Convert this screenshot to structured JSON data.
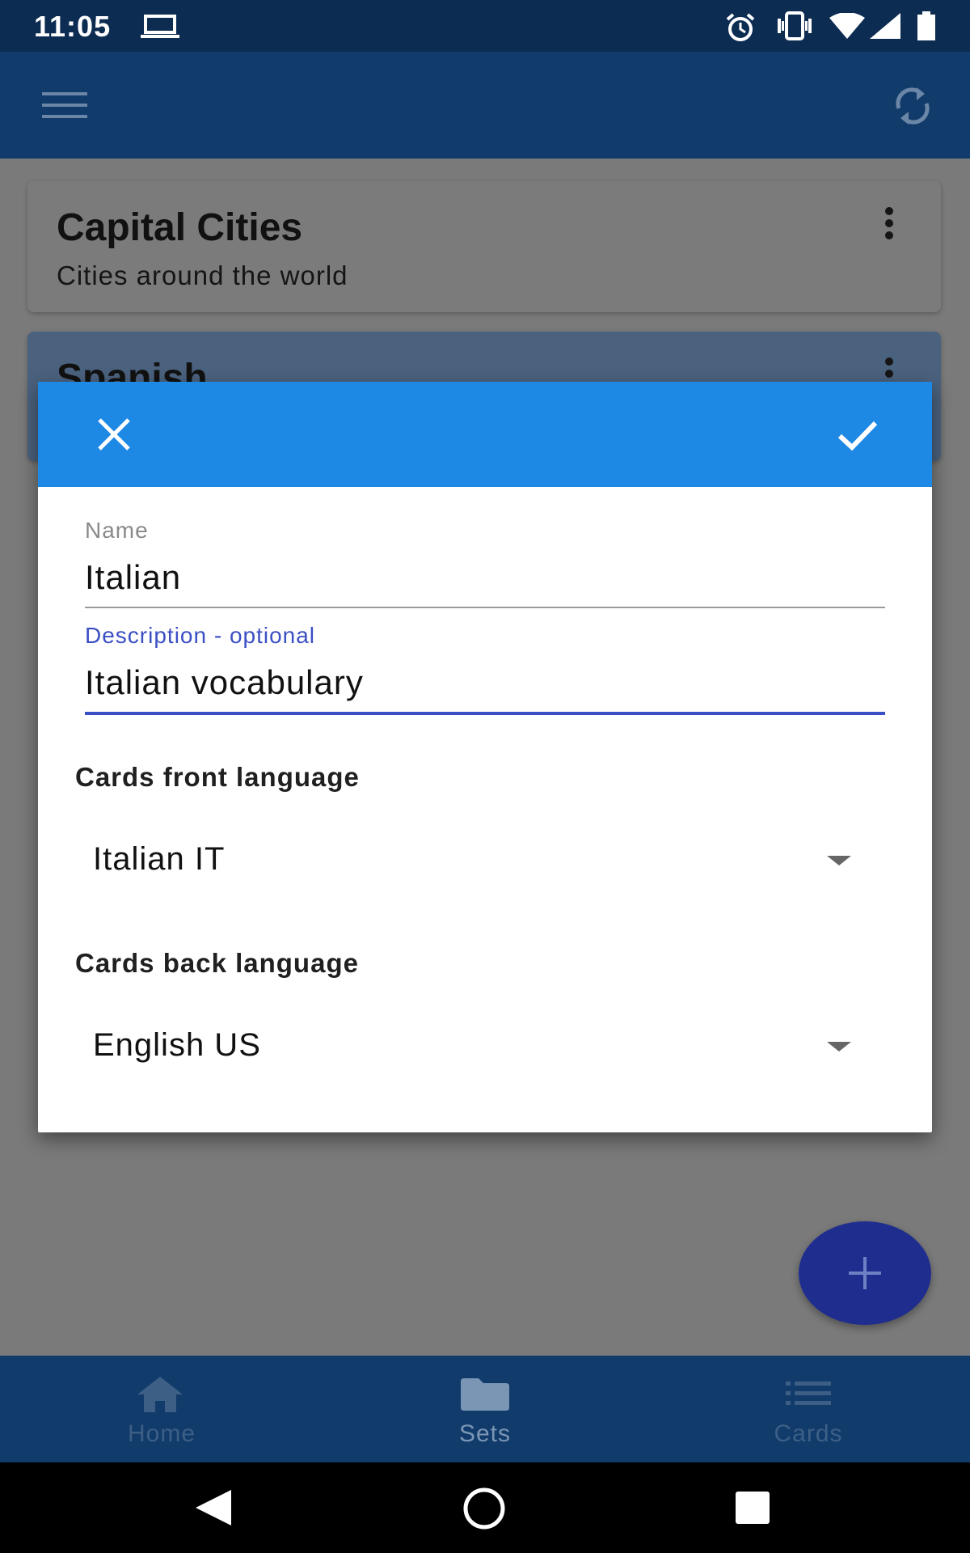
{
  "status_bar": {
    "time": "11:05",
    "icons": [
      "laptop-icon",
      "alarm-icon",
      "vibrate-icon",
      "wifi-icon",
      "signal-icon",
      "battery-icon"
    ]
  },
  "app_bar": {
    "menu_icon": "hamburger-menu-icon",
    "sync_icon": "sync-icon"
  },
  "sets": [
    {
      "title": "Capital Cities",
      "description": "Cities around the world"
    },
    {
      "title": "Spanish",
      "description": ""
    }
  ],
  "dialog": {
    "close_icon": "close-icon",
    "confirm_icon": "check-icon",
    "name_field": {
      "label": "Name",
      "value": "Italian"
    },
    "description_field": {
      "label": "Description - optional",
      "value": "Italian vocabulary"
    },
    "front_language": {
      "label": "Cards front language",
      "value": "Italian IT"
    },
    "back_language": {
      "label": "Cards back language",
      "value": "English US"
    }
  },
  "fab": {
    "icon": "plus-icon"
  },
  "bottom_nav": {
    "items": [
      {
        "label": "Home",
        "icon": "home-icon",
        "active": false
      },
      {
        "label": "Sets",
        "icon": "folder-icon",
        "active": true
      },
      {
        "label": "Cards",
        "icon": "list-icon",
        "active": false
      }
    ]
  },
  "colors": {
    "status_bar": "#0d2c52",
    "app_bar": "#103b6b",
    "dialog_header": "#1e88e5",
    "accent": "#3b4fc4",
    "fab": "#1f2d8f"
  }
}
